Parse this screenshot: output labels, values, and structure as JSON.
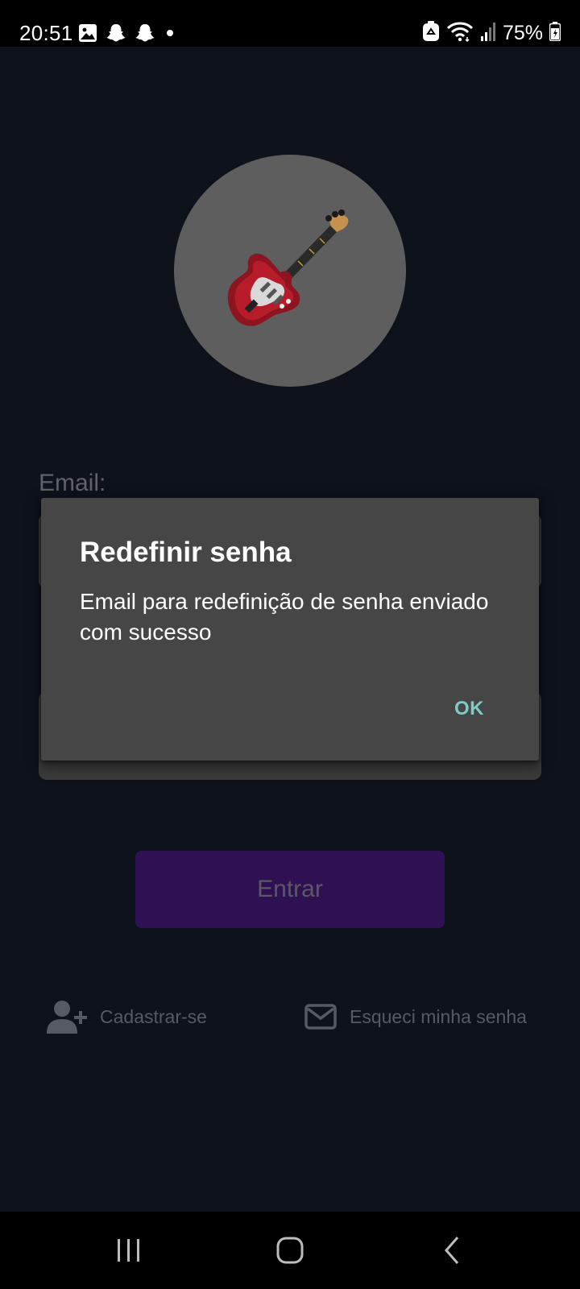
{
  "status_bar": {
    "time": "20:51",
    "battery": "75%",
    "left_icons": [
      "gallery-icon",
      "snapchat-icon",
      "snapchat-icon",
      "dot-icon"
    ],
    "right_icons": [
      "recycle-icon",
      "wifi-icon",
      "signal-icon",
      "battery-icon"
    ]
  },
  "login": {
    "logo": "guitar-icon",
    "email_label": "Email:",
    "email_value": "",
    "password_value": "",
    "login_button": "Entrar",
    "signup_link": "Cadastrar-se",
    "forgot_link": "Esqueci minha senha"
  },
  "dialog": {
    "title": "Redefinir senha",
    "message": "Email para redefinição de senha enviado com sucesso",
    "ok_button": "OK"
  },
  "colors": {
    "app_background": "#0d121b",
    "dialog_background": "#464646",
    "accent": "#80cbc4",
    "button_purple": "#2f1052"
  }
}
